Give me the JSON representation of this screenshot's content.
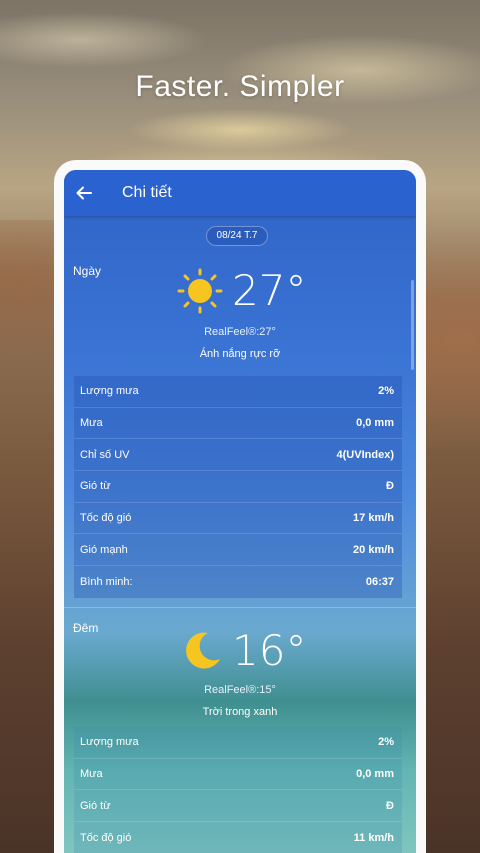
{
  "headline": "Faster. Simpler",
  "appbar": {
    "title": "Chi tiết"
  },
  "date": "08/24 T.7",
  "day": {
    "label": "Ngày",
    "temp": "27°",
    "realfeel": "RealFeel®:27°",
    "condition": "Ánh nắng rực rỡ",
    "icon": "sun-icon",
    "rows": [
      {
        "label": "Lượng mưa",
        "value": "2%"
      },
      {
        "label": "Mưa",
        "value": "0,0 mm"
      },
      {
        "label": "Chỉ số UV",
        "value": "4(UVIndex)"
      },
      {
        "label": "Gió từ",
        "value": "Đ"
      },
      {
        "label": "Tốc độ gió",
        "value": "17 km/h"
      },
      {
        "label": "Gió mạnh",
        "value": "20 km/h"
      },
      {
        "label": "Bình minh:",
        "value": "06:37"
      }
    ]
  },
  "night": {
    "label": "Đêm",
    "temp": "16°",
    "realfeel": "RealFeel®:15°",
    "condition": "Trời trong xanh",
    "icon": "moon-icon",
    "rows": [
      {
        "label": "Lượng mưa",
        "value": "2%"
      },
      {
        "label": "Mưa",
        "value": "0,0 mm"
      },
      {
        "label": "Gió từ",
        "value": "Đ"
      },
      {
        "label": "Tốc độ gió",
        "value": "11 km/h"
      }
    ]
  }
}
